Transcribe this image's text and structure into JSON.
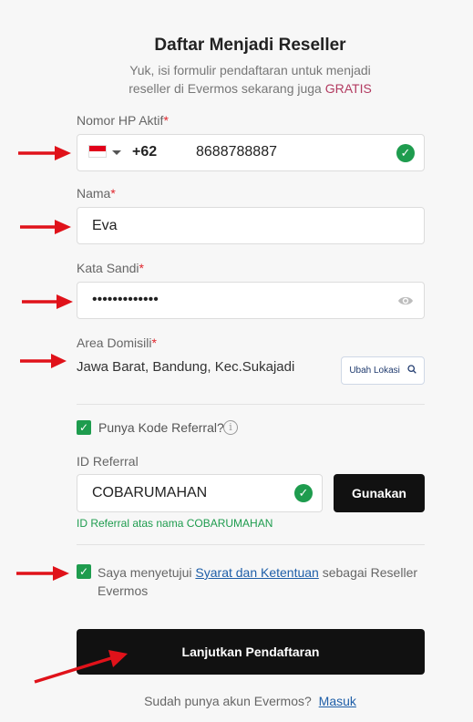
{
  "header": {
    "title": "Daftar Menjadi Reseller",
    "subtitle_line1": "Yuk, isi formulir pendaftaran untuk menjadi",
    "subtitle_line2_prefix": "reseller di Evermos sekarang juga",
    "subtitle_highlight": "GRATIS"
  },
  "form": {
    "phone": {
      "label": "Nomor HP Aktif",
      "required_mark": "*",
      "country_code": "+62",
      "value": "8688788887",
      "flag": "indonesia-flag-icon",
      "valid": true
    },
    "name": {
      "label": "Nama",
      "required_mark": "*",
      "value": "Eva"
    },
    "password": {
      "label": "Kata Sandi",
      "required_mark": "*",
      "value": "•••••••••••••"
    },
    "area": {
      "label": "Area Domisili",
      "required_mark": "*",
      "value": "Jawa Barat, Bandung, Kec.Sukajadi",
      "change_button": "Ubah Lokasi"
    },
    "referral_checkbox": {
      "label": "Punya Kode Referral?",
      "checked": true
    },
    "referral": {
      "label": "ID Referral",
      "value": "COBARUMAHAN",
      "apply_button": "Gunakan",
      "note": "ID Referral atas nama COBARUMAHAN",
      "valid": true
    },
    "terms": {
      "checked": true,
      "prefix": "Saya menyetujui",
      "link": "Syarat dan Ketentuan",
      "suffix": "sebagai Reseller Evermos"
    },
    "submit_label": "Lanjutkan Pendaftaran"
  },
  "footer": {
    "question": "Sudah punya akun Evermos?",
    "login_link": "Masuk"
  },
  "colors": {
    "accent_green": "#1e9c4e",
    "brand_magenta": "#b23a60",
    "link_blue": "#1f5fa8",
    "annotation_red": "#e0121a",
    "button_dark": "#111111"
  }
}
